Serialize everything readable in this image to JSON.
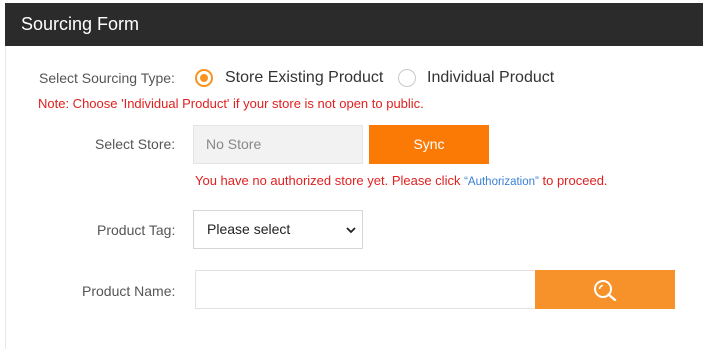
{
  "header": {
    "title": "Sourcing Form"
  },
  "form": {
    "sourcing_type": {
      "label": "Select Sourcing Type:",
      "options": [
        "Store Existing Product",
        "Individual Product"
      ],
      "selected": "Store Existing Product"
    },
    "note": "Note: Choose 'Individual Product' if your store is not open to public.",
    "store": {
      "label": "Select Store:",
      "value": "No Store",
      "sync_label": "Sync",
      "warning_before": "You have no authorized store yet. Please click ",
      "authorization_link": "“Authorization”",
      "warning_after": " to proceed."
    },
    "product_tag": {
      "label": "Product Tag:",
      "selected": "Please select"
    },
    "product_name": {
      "label": "Product Name:",
      "value": ""
    }
  },
  "colors": {
    "header_bg": "#2b2b2b",
    "accent": "#f7931e",
    "sync_button": "#fb7a06",
    "error_text": "#e02020",
    "link": "#3a7fd6"
  },
  "icons": {
    "search_button": "search-icon",
    "select": "chevron-down-icon"
  }
}
